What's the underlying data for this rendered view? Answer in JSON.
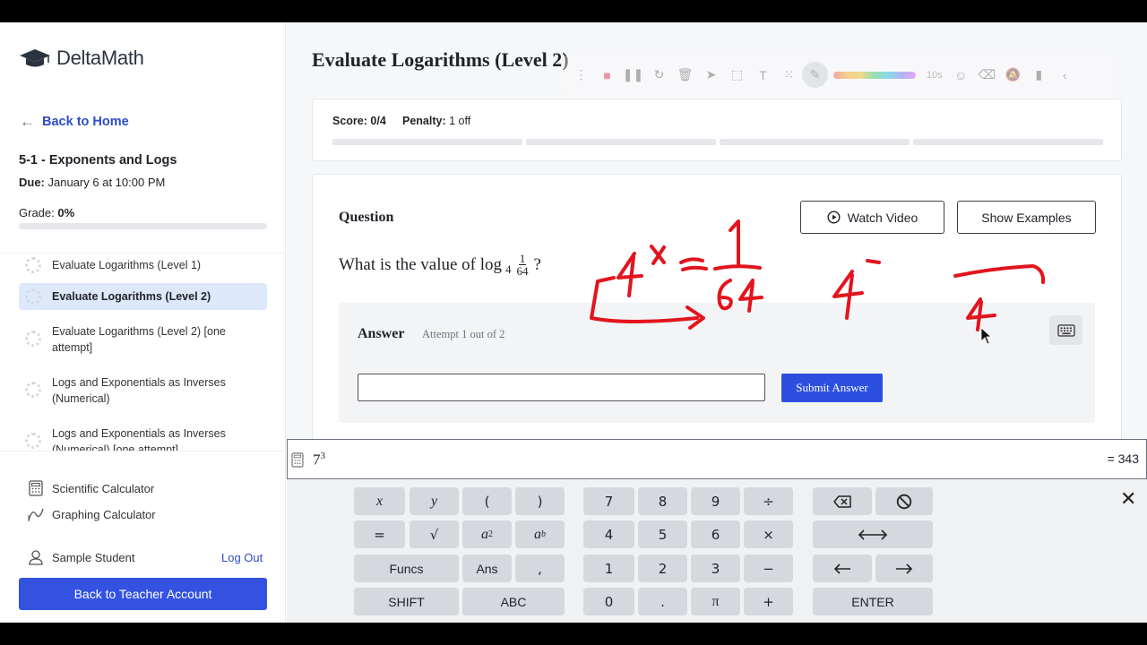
{
  "app": {
    "name": "DeltaMath"
  },
  "sidebar": {
    "back_home": "Back to Home",
    "assignment_title": "5-1 - Exponents and Logs",
    "due_label": "Due:",
    "due_value": "January 6 at 10:00 PM",
    "grade_label": "Grade:",
    "grade_value": "0%",
    "grade_fraction": 0,
    "skills": [
      {
        "label": "Evaluate Logarithms (Level 1)",
        "active": false
      },
      {
        "label": "Evaluate Logarithms (Level 2)",
        "active": true
      },
      {
        "label": "Evaluate Logarithms (Level 2) [one attempt]",
        "active": false
      },
      {
        "label": "Logs and Exponentials as Inverses (Numerical)",
        "active": false
      },
      {
        "label": "Logs and Exponentials as Inverses (Numerical) [one attempt]",
        "active": false
      }
    ],
    "tools": {
      "scientific": "Scientific Calculator",
      "graphing": "Graphing Calculator"
    },
    "student_name": "Sample Student",
    "logout": "Log Out",
    "teacher_button": "Back to Teacher Account"
  },
  "main": {
    "title": "Evaluate Logarithms (Level 2)",
    "score_label": "Score:",
    "score_value": "0/4",
    "penalty_label": "Penalty:",
    "penalty_value": "1 off",
    "toolbar_timer": "10s",
    "question_label": "Question",
    "watch_video": "Watch Video",
    "show_examples": "Show Examples",
    "question": {
      "prefix": "What is the value of log",
      "base": "4",
      "numerator": "1",
      "denominator": "64",
      "suffix": "?"
    },
    "answer_label": "Answer",
    "attempt_text": "Attempt 1 out of 2",
    "submit": "Submit Answer"
  },
  "calculator": {
    "expression_base": "7",
    "expression_exp": "3",
    "result": "= 343",
    "keys": {
      "x": "x",
      "y": "y",
      "lparen": "(",
      "rparen": ")",
      "equals": "=",
      "sqrt": "√",
      "a": "a",
      "sq": "2",
      "b": "b",
      "funcs": "Funcs",
      "ans": "Ans",
      "comma": ",",
      "shift": "SHIFT",
      "abc": "ABC",
      "n7": "7",
      "n8": "8",
      "n9": "9",
      "div": "÷",
      "n4": "4",
      "n5": "5",
      "n6": "6",
      "mul": "×",
      "n1": "1",
      "n2": "2",
      "n3": "3",
      "minus": "−",
      "n0": "0",
      "dot": ".",
      "pi": "π",
      "plus": "+",
      "enter": "ENTER",
      "close": "✕"
    }
  }
}
